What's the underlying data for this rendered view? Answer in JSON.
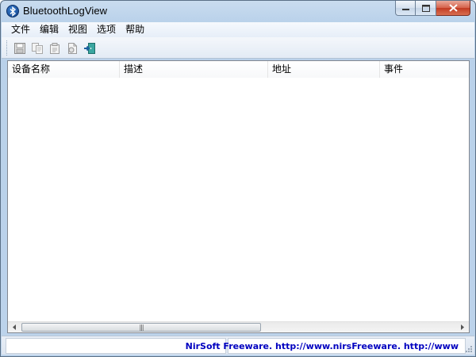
{
  "window": {
    "title": "BluetoothLogView",
    "icon": "bluetooth-icon"
  },
  "caption_buttons": {
    "minimize": "minimize-icon",
    "maximize": "maximize-icon",
    "close": "close-icon"
  },
  "menu": {
    "items": [
      {
        "label": "文件"
      },
      {
        "label": "编辑"
      },
      {
        "label": "视图"
      },
      {
        "label": "选项"
      },
      {
        "label": "帮助"
      }
    ]
  },
  "toolbar": {
    "buttons": [
      {
        "icon": "save-icon"
      },
      {
        "icon": "copy-icon"
      },
      {
        "icon": "properties-icon"
      },
      {
        "icon": "html-report-icon"
      },
      {
        "icon": "exit-icon"
      }
    ]
  },
  "list": {
    "columns": [
      {
        "label": "设备名称"
      },
      {
        "label": "描述"
      },
      {
        "label": "地址"
      },
      {
        "label": "事件"
      }
    ],
    "rows": []
  },
  "statusbar": {
    "link_text": "NirSoft Freeware.  http://www.nirsoft.net",
    "link_visible_text": "NirSoft Freeware.  http://www.nirsFreeware.  http://www"
  },
  "colors": {
    "link": "#0000c0",
    "close_button": "#c23b22",
    "title_bar": "#c9dcef"
  }
}
